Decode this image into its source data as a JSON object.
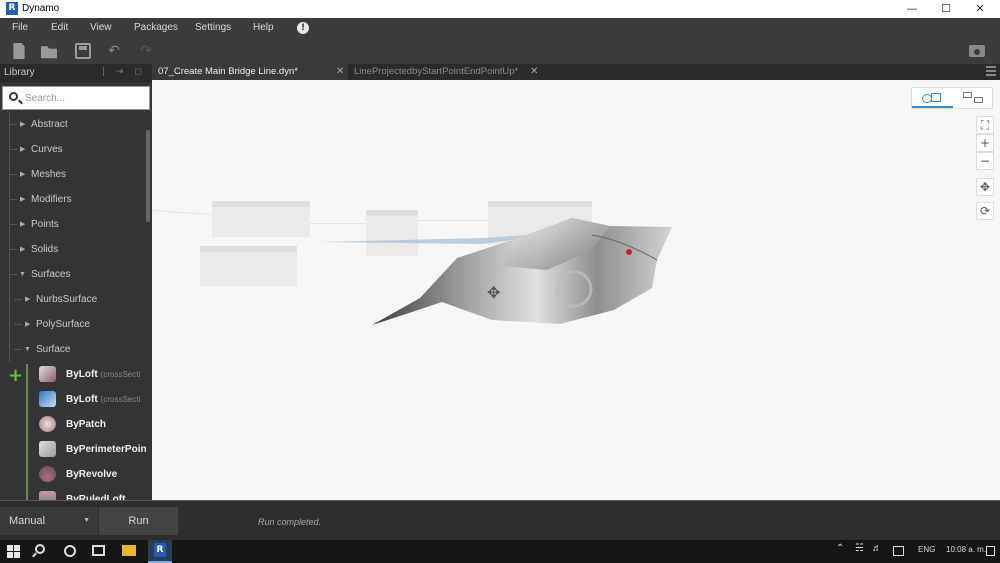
{
  "window": {
    "title": "Dynamo",
    "logo_letter": "R"
  },
  "menu": {
    "items": [
      "File",
      "Edit",
      "View",
      "Packages",
      "Settings",
      "Help"
    ],
    "alert_glyph": "!"
  },
  "toolbar": {
    "icons": [
      "new-file-icon",
      "open-file-icon",
      "save-icon",
      "undo-icon",
      "redo-icon",
      "screenshot-camera-icon"
    ]
  },
  "library": {
    "title": "Library",
    "search_placeholder": "Search...",
    "categories": [
      {
        "label": "Abstract",
        "expanded": false
      },
      {
        "label": "Curves",
        "expanded": false
      },
      {
        "label": "Meshes",
        "expanded": false
      },
      {
        "label": "Modifiers",
        "expanded": false
      },
      {
        "label": "Points",
        "expanded": false
      },
      {
        "label": "Solids",
        "expanded": false
      },
      {
        "label": "Surfaces",
        "expanded": true
      }
    ],
    "subcategories": [
      {
        "label": "NurbsSurface",
        "expanded": false
      },
      {
        "label": "PolySurface",
        "expanded": false
      },
      {
        "label": "Surface",
        "expanded": true
      }
    ],
    "nodes": [
      {
        "name": "ByLoft",
        "params": "(crossSecti",
        "icon": "loft-icon"
      },
      {
        "name": "ByLoft",
        "params": "(crossSecti",
        "icon": "loft-guide-icon"
      },
      {
        "name": "ByPatch",
        "params": "",
        "icon": "patch-icon"
      },
      {
        "name": "ByPerimeterPoin",
        "params": "",
        "icon": "perimeter-points-icon"
      },
      {
        "name": "ByRevolve",
        "params": "",
        "icon": "revolve-icon"
      },
      {
        "name": "ByRuledLoft",
        "params": "",
        "icon": "ruled-loft-icon"
      }
    ]
  },
  "tabs": [
    {
      "label": "07_Create Main Bridge Line.dyn*",
      "active": true
    },
    {
      "label": "LineProjectedbyStartPointEndPointUp*",
      "active": false
    }
  ],
  "canvas": {
    "view_modes": [
      "3d-geometry-view-icon",
      "graph-node-view-icon"
    ],
    "nav_buttons": [
      "zoom-to-fit-icon",
      "zoom-in-icon",
      "zoom-out-icon",
      "pan-icon",
      "orbit-icon"
    ]
  },
  "runbar": {
    "mode": "Manual",
    "run_label": "Run",
    "status": "Run completed."
  },
  "taskbar": {
    "language": "ENG",
    "time": "10:08 a. m."
  },
  "colors": {
    "accent_blue": "#3a8fc8",
    "add_green": "#6bbf3a",
    "dark_chrome": "#3c3c3c",
    "canvas_bg": "#f6f6f6"
  }
}
